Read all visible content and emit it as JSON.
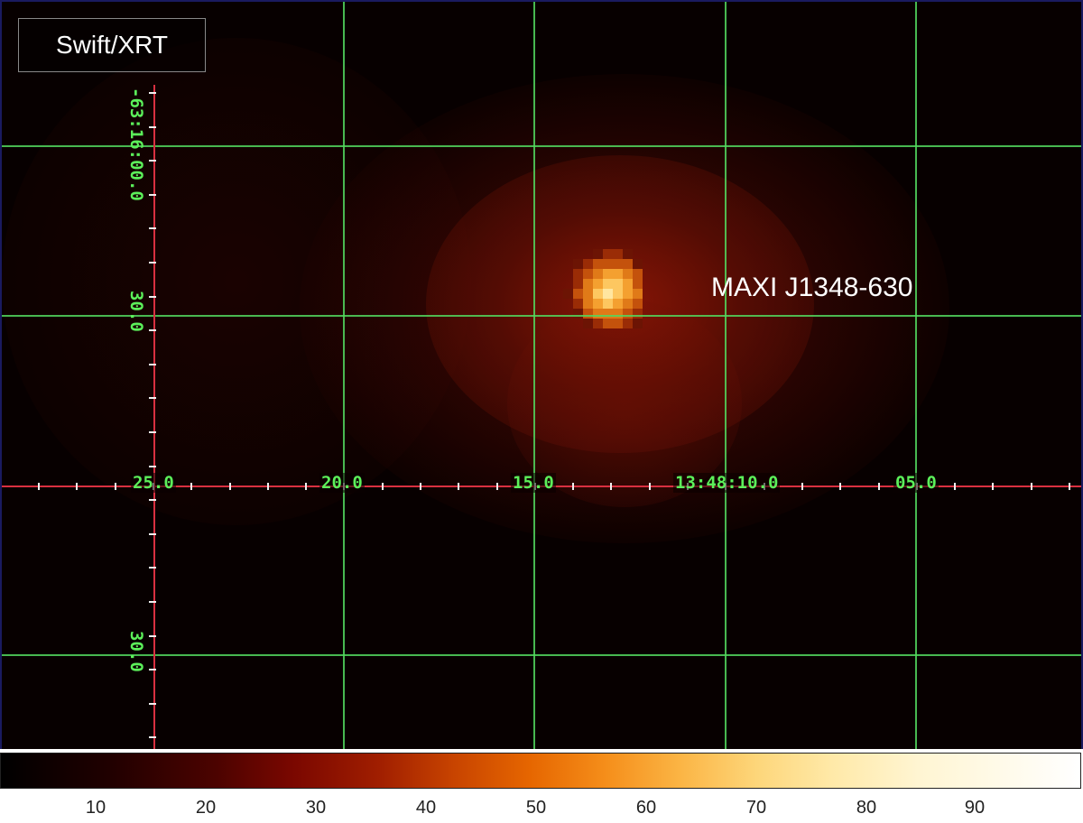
{
  "image": {
    "instrument_label": "Swift/XRT",
    "source_label": "MAXI J1348-630",
    "ra_labels": [
      "25.0",
      "20.0",
      "15.0",
      "13:48:10.0",
      "05.0"
    ],
    "dec_labels": [
      "-63:16:00.0",
      "30.0",
      "30.0"
    ]
  },
  "colorbar": {
    "labels": [
      "10",
      "20",
      "30",
      "40",
      "50",
      "60",
      "70",
      "80",
      "90"
    ],
    "colormap": "heat",
    "colors": [
      "#000000",
      "#4c0300",
      "#a01e00",
      "#e66600",
      "#fbb545",
      "#ffe9a8",
      "#ffffff"
    ]
  },
  "colors": {
    "grid": "#52d85e",
    "axis": "#d83040",
    "label_text": "#5cf05a"
  }
}
